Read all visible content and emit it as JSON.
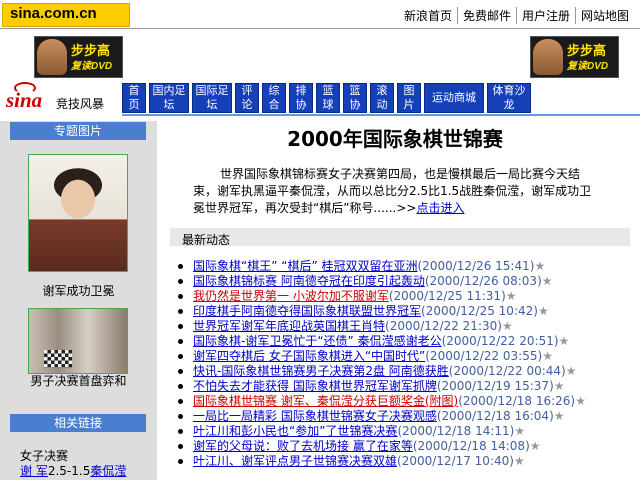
{
  "site_logo": "sina.com.cn",
  "top_links": [
    "新浪首页",
    "免费邮件",
    "用户注册",
    "网站地图"
  ],
  "ad": {
    "brand": "步步高",
    "sub": "复读DVD"
  },
  "sina_logo": "sina",
  "section_name": "竞技风暴",
  "nav": [
    "首页",
    "国内足坛",
    "国际足坛",
    "评论",
    "综合",
    "排协",
    "篮球",
    "篮协",
    "滚动",
    "图片",
    "运动商城",
    "体育沙龙"
  ],
  "sidebar": {
    "photo_heading": "专题图片",
    "photo1_caption": "谢军成功卫冕",
    "photo2_caption": "男子决赛首盘弈和",
    "links_heading": "相关链接",
    "link1": "女子决赛",
    "link2_name": "谢 军",
    "link2_score": "2.5-1.5",
    "link2_opponent": "秦侃滢"
  },
  "main": {
    "title": "2000年国际象棋世锦赛",
    "intro": "世界国际象棋锦标赛女子决赛第四局，也是慢棋最后一局比赛今天结束，谢军执黑逼平秦侃滢，从而以总比分2.5比1.5战胜秦侃滢，谢军成功卫冕世界冠军，再次受封“棋后”称号......>>",
    "intro_link": "点击进入",
    "news_heading": "最新动态",
    "news": [
      {
        "title": "国际象棋“棋王” “棋后”  桂冠双双留在亚洲",
        "date": "(2000/12/26 15:41)",
        "red": false
      },
      {
        "title": "国际象棋锦标赛 阿南德夺冠在印度引起轰动",
        "date": "(2000/12/26 08:03)",
        "red": false
      },
      {
        "title": "我仍然是世界第一 小波尔加不服谢军",
        "date": "(2000/12/25 11:31)",
        "red": true
      },
      {
        "title": "印度棋手阿南德夺得国际象棋联盟世界冠军",
        "date": "(2000/12/25 10:42)",
        "red": false
      },
      {
        "title": "世界冠军谢军年底迎战英国棋王肖特",
        "date": "(2000/12/22 21:30)",
        "red": false
      },
      {
        "title": "国际象棋-谢军卫冕忙于“还债”  秦侃滢感谢老公",
        "date": "(2000/12/22 20:51)",
        "red": false
      },
      {
        "title": "谢军四夺棋后 女子国际象棋进入“中国时代”",
        "date": "(2000/12/22 03:55)",
        "red": false
      },
      {
        "title": "快讯-国际象棋世锦赛男子决赛第2盘 阿南德获胜",
        "date": "(2000/12/22 00:44)",
        "red": false
      },
      {
        "title": "不怕失去才能获得 国际象棋世界冠军谢军抓牌",
        "date": "(2000/12/19 15:37)",
        "red": false
      },
      {
        "title": "国际象棋世锦赛 谢军、秦侃滢分获巨额奖金(附图)",
        "date": "(2000/12/18 16:26)",
        "red": true
      },
      {
        "title": "一局比一局精彩 国际象棋世锦赛女子决赛观感",
        "date": "(2000/12/18 16:04)",
        "red": false
      },
      {
        "title": "叶江川和彭小民也“参加”了世锦赛决赛",
        "date": "(2000/12/18 14:11)",
        "red": false
      },
      {
        "title": "谢军的父母说：败了去机场接 赢了在家等",
        "date": "(2000/12/18 14:08)",
        "red": false
      },
      {
        "title": "叶江川、谢军评点男子世锦赛决赛双雄",
        "date": "(2000/12/17 10:40)",
        "red": false
      }
    ]
  }
}
